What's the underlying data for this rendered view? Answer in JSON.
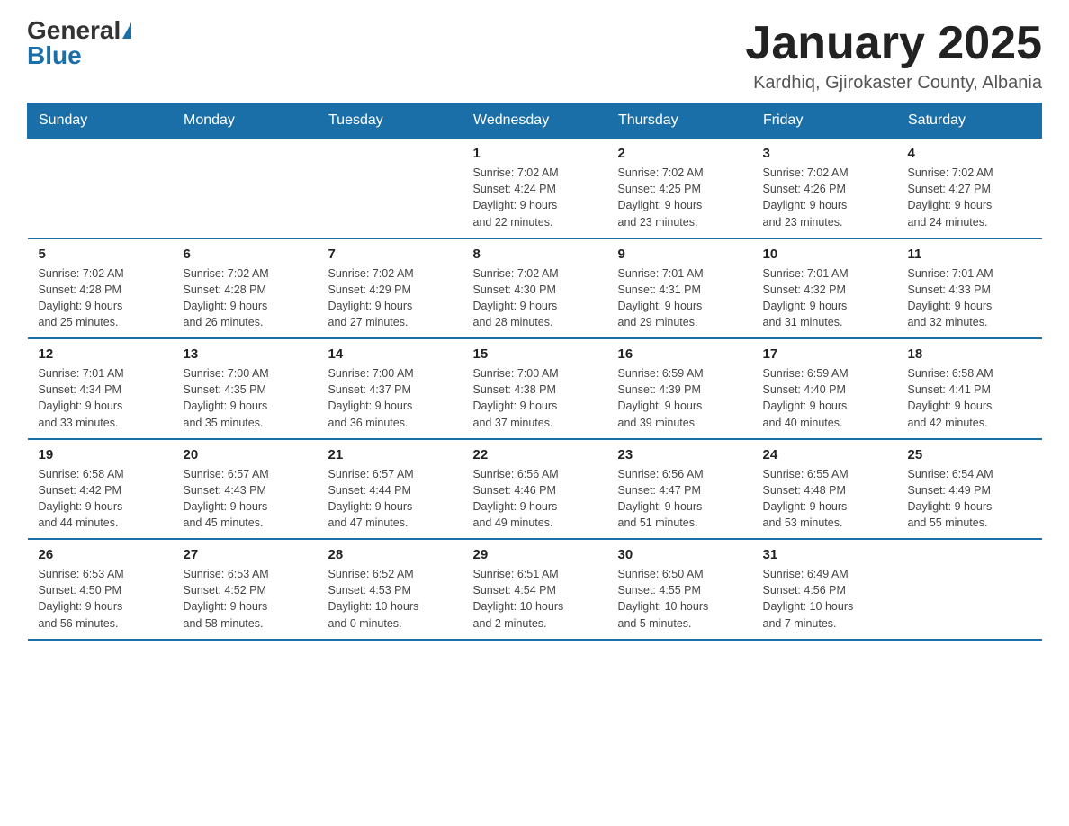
{
  "logo": {
    "general": "General",
    "blue": "Blue"
  },
  "title": "January 2025",
  "location": "Kardhiq, Gjirokaster County, Albania",
  "days_of_week": [
    "Sunday",
    "Monday",
    "Tuesday",
    "Wednesday",
    "Thursday",
    "Friday",
    "Saturday"
  ],
  "weeks": [
    [
      {
        "day": "",
        "info": ""
      },
      {
        "day": "",
        "info": ""
      },
      {
        "day": "",
        "info": ""
      },
      {
        "day": "1",
        "info": "Sunrise: 7:02 AM\nSunset: 4:24 PM\nDaylight: 9 hours\nand 22 minutes."
      },
      {
        "day": "2",
        "info": "Sunrise: 7:02 AM\nSunset: 4:25 PM\nDaylight: 9 hours\nand 23 minutes."
      },
      {
        "day": "3",
        "info": "Sunrise: 7:02 AM\nSunset: 4:26 PM\nDaylight: 9 hours\nand 23 minutes."
      },
      {
        "day": "4",
        "info": "Sunrise: 7:02 AM\nSunset: 4:27 PM\nDaylight: 9 hours\nand 24 minutes."
      }
    ],
    [
      {
        "day": "5",
        "info": "Sunrise: 7:02 AM\nSunset: 4:28 PM\nDaylight: 9 hours\nand 25 minutes."
      },
      {
        "day": "6",
        "info": "Sunrise: 7:02 AM\nSunset: 4:28 PM\nDaylight: 9 hours\nand 26 minutes."
      },
      {
        "day": "7",
        "info": "Sunrise: 7:02 AM\nSunset: 4:29 PM\nDaylight: 9 hours\nand 27 minutes."
      },
      {
        "day": "8",
        "info": "Sunrise: 7:02 AM\nSunset: 4:30 PM\nDaylight: 9 hours\nand 28 minutes."
      },
      {
        "day": "9",
        "info": "Sunrise: 7:01 AM\nSunset: 4:31 PM\nDaylight: 9 hours\nand 29 minutes."
      },
      {
        "day": "10",
        "info": "Sunrise: 7:01 AM\nSunset: 4:32 PM\nDaylight: 9 hours\nand 31 minutes."
      },
      {
        "day": "11",
        "info": "Sunrise: 7:01 AM\nSunset: 4:33 PM\nDaylight: 9 hours\nand 32 minutes."
      }
    ],
    [
      {
        "day": "12",
        "info": "Sunrise: 7:01 AM\nSunset: 4:34 PM\nDaylight: 9 hours\nand 33 minutes."
      },
      {
        "day": "13",
        "info": "Sunrise: 7:00 AM\nSunset: 4:35 PM\nDaylight: 9 hours\nand 35 minutes."
      },
      {
        "day": "14",
        "info": "Sunrise: 7:00 AM\nSunset: 4:37 PM\nDaylight: 9 hours\nand 36 minutes."
      },
      {
        "day": "15",
        "info": "Sunrise: 7:00 AM\nSunset: 4:38 PM\nDaylight: 9 hours\nand 37 minutes."
      },
      {
        "day": "16",
        "info": "Sunrise: 6:59 AM\nSunset: 4:39 PM\nDaylight: 9 hours\nand 39 minutes."
      },
      {
        "day": "17",
        "info": "Sunrise: 6:59 AM\nSunset: 4:40 PM\nDaylight: 9 hours\nand 40 minutes."
      },
      {
        "day": "18",
        "info": "Sunrise: 6:58 AM\nSunset: 4:41 PM\nDaylight: 9 hours\nand 42 minutes."
      }
    ],
    [
      {
        "day": "19",
        "info": "Sunrise: 6:58 AM\nSunset: 4:42 PM\nDaylight: 9 hours\nand 44 minutes."
      },
      {
        "day": "20",
        "info": "Sunrise: 6:57 AM\nSunset: 4:43 PM\nDaylight: 9 hours\nand 45 minutes."
      },
      {
        "day": "21",
        "info": "Sunrise: 6:57 AM\nSunset: 4:44 PM\nDaylight: 9 hours\nand 47 minutes."
      },
      {
        "day": "22",
        "info": "Sunrise: 6:56 AM\nSunset: 4:46 PM\nDaylight: 9 hours\nand 49 minutes."
      },
      {
        "day": "23",
        "info": "Sunrise: 6:56 AM\nSunset: 4:47 PM\nDaylight: 9 hours\nand 51 minutes."
      },
      {
        "day": "24",
        "info": "Sunrise: 6:55 AM\nSunset: 4:48 PM\nDaylight: 9 hours\nand 53 minutes."
      },
      {
        "day": "25",
        "info": "Sunrise: 6:54 AM\nSunset: 4:49 PM\nDaylight: 9 hours\nand 55 minutes."
      }
    ],
    [
      {
        "day": "26",
        "info": "Sunrise: 6:53 AM\nSunset: 4:50 PM\nDaylight: 9 hours\nand 56 minutes."
      },
      {
        "day": "27",
        "info": "Sunrise: 6:53 AM\nSunset: 4:52 PM\nDaylight: 9 hours\nand 58 minutes."
      },
      {
        "day": "28",
        "info": "Sunrise: 6:52 AM\nSunset: 4:53 PM\nDaylight: 10 hours\nand 0 minutes."
      },
      {
        "day": "29",
        "info": "Sunrise: 6:51 AM\nSunset: 4:54 PM\nDaylight: 10 hours\nand 2 minutes."
      },
      {
        "day": "30",
        "info": "Sunrise: 6:50 AM\nSunset: 4:55 PM\nDaylight: 10 hours\nand 5 minutes."
      },
      {
        "day": "31",
        "info": "Sunrise: 6:49 AM\nSunset: 4:56 PM\nDaylight: 10 hours\nand 7 minutes."
      },
      {
        "day": "",
        "info": ""
      }
    ]
  ]
}
